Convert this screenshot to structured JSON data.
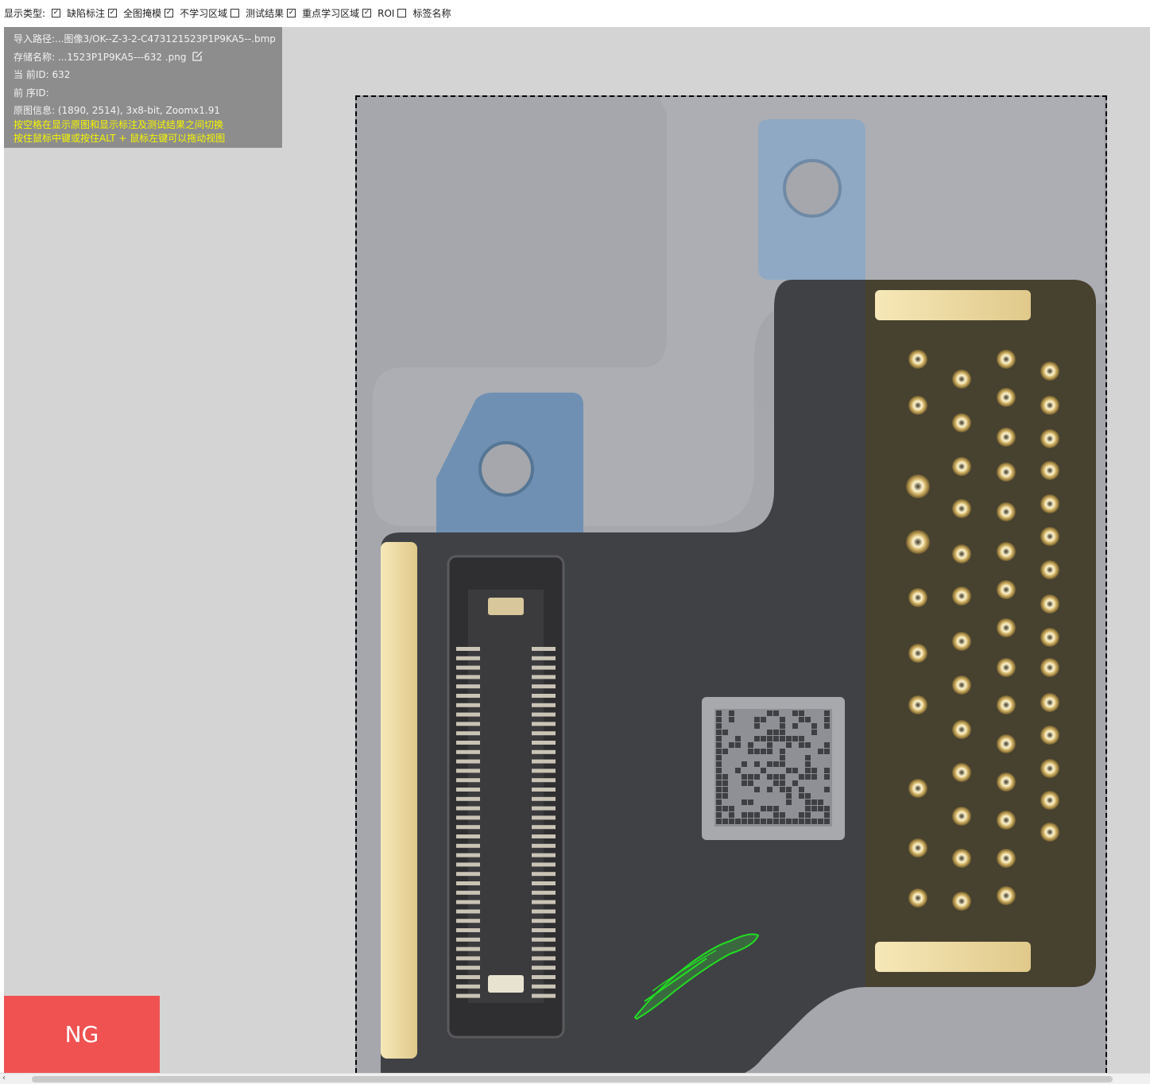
{
  "toolbar": {
    "label": "显示类型:",
    "options": [
      {
        "label": "缺陷标注",
        "checked": true
      },
      {
        "label": "全图掩模",
        "checked": true
      },
      {
        "label": "不学习区域",
        "checked": true
      },
      {
        "label": "测试结果",
        "checked": false
      },
      {
        "label": "重点学习区域",
        "checked": true
      },
      {
        "label": "ROI",
        "checked": true
      },
      {
        "label": "标签名称",
        "checked": false
      }
    ]
  },
  "info": {
    "import_path": "导入路径:...图像3/OK--Z-3-2-C473121523P1P9KA5--.bmp",
    "save_name": "存储名称: ...1523P1P9KA5---632 .png",
    "current_id": "当 前ID: 632",
    "previous_id": "前 序ID:",
    "image_info": "原图信息: (1890, 2514), 3x8-bit, Zoomx1.91",
    "hint_space": "按空格在显示原图和显示标注及测试结果之间切换",
    "hint_drag": "按住鼠标中键或按住ALT + 鼠标左键可以拖动视图"
  },
  "result": {
    "label": "NG",
    "color": "#f05252"
  },
  "colors": {
    "hint": "#f5f500",
    "defect_outline": "#22dd22",
    "canvas_bg": "#d4d4d4"
  },
  "scrollbar": {
    "arrow": "‹"
  }
}
